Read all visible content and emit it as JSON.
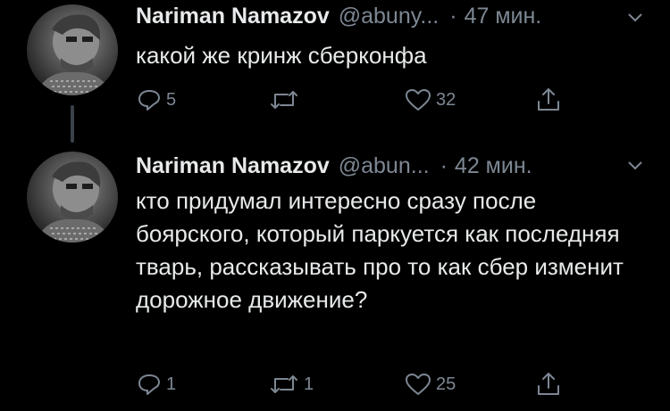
{
  "tweets": [
    {
      "author_name": "Nariman Namazov",
      "handle": "@abuny...",
      "dot": "·",
      "time": "47 мин.",
      "text": "какой же кринж сберконфа",
      "replies": "5",
      "retweets": "",
      "likes": "32"
    },
    {
      "author_name": "Nariman Namazov",
      "handle": "@abun...",
      "dot": "·",
      "time": "42 мин.",
      "text": "кто придумал интересно сразу после боярского, который паркуется как последняя тварь, рассказывать про то как сбер изменит дорожное движение?",
      "replies": "1",
      "retweets": "1",
      "likes": "25"
    }
  ],
  "icons": {
    "reply": "reply-icon",
    "retweet": "retweet-icon",
    "like": "heart-icon",
    "share": "share-icon",
    "menu": "chevron-down-icon",
    "avatar": "avatar"
  },
  "colors": {
    "background": "#000000",
    "text": "#e7e9ea",
    "secondary": "#7d8793",
    "thread_line": "#3a4148"
  }
}
